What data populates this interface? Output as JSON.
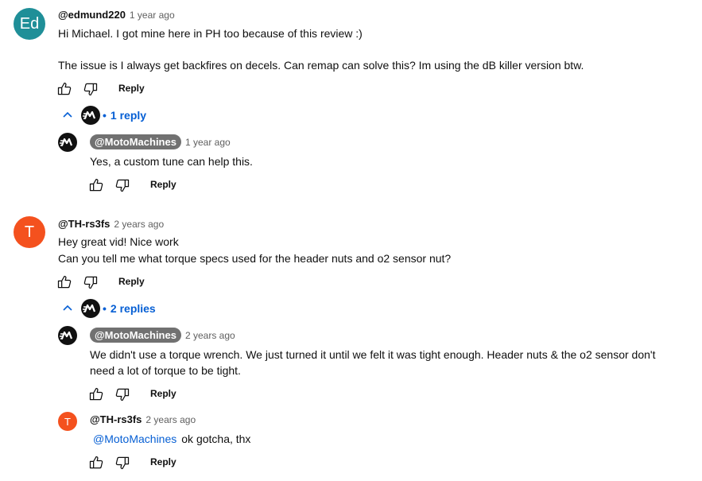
{
  "colors": {
    "link": "#065fd4",
    "avatar_ed": "#1f8f98",
    "avatar_t": "#f4511e",
    "badge_bg": "#717171"
  },
  "comments": [
    {
      "avatar_text": "Ed",
      "author": "@edmund220",
      "time": "1 year ago",
      "line1": "Hi Michael. I got mine here in PH too because of this review :)",
      "line2": "The issue is I always get backfires on decels. Can remap can solve this? Im using the dB killer version btw.",
      "reply_label": "Reply",
      "replies_toggle": "1 reply",
      "replies": [
        {
          "author": "@MotoMachines",
          "time": "1 year ago",
          "text": "Yes, a custom tune can help this.",
          "reply_label": "Reply"
        }
      ]
    },
    {
      "avatar_text": "T",
      "author": "@TH-rs3fs",
      "time": "2 years ago",
      "line1": "Hey great vid! Nice work",
      "line2": "Can you tell me what torque specs used for the header nuts and o2 sensor nut?",
      "reply_label": "Reply",
      "replies_toggle": "2 replies",
      "replies": [
        {
          "author": "@MotoMachines",
          "time": "2 years ago",
          "line1": "We didn't use a torque wrench. We just turned it until we felt it was tight enough. Header nuts & the o2 sensor don't",
          "line2": "need a lot of torque to be tight.",
          "reply_label": "Reply"
        },
        {
          "avatar_text": "T",
          "author": "@TH-rs3fs",
          "time": "2 years ago",
          "mention": "@MotoMachines",
          "text": "ok gotcha, thx",
          "reply_label": "Reply"
        }
      ]
    }
  ],
  "icons": {
    "like": "thumbs-up-icon",
    "dislike": "thumbs-down-icon",
    "chevron": "chevron-up-icon",
    "logo": "motomachines-logo"
  }
}
